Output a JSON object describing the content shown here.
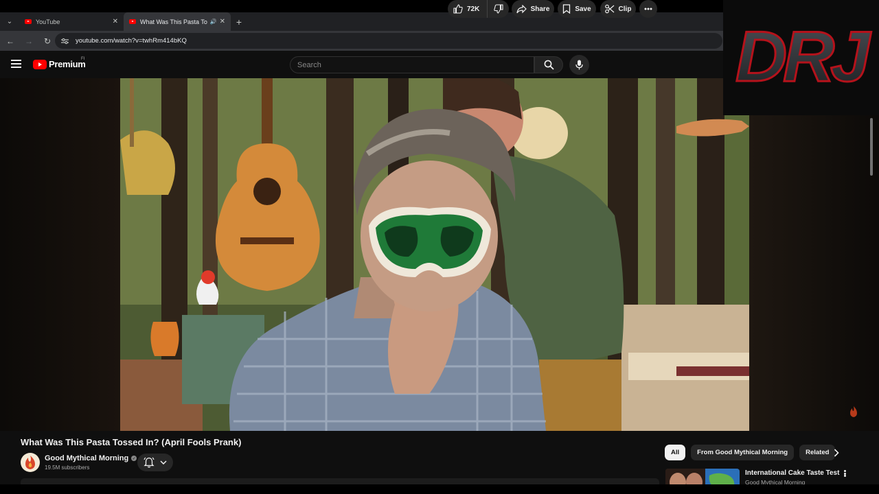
{
  "browser": {
    "tabs": [
      {
        "title": "YouTube",
        "active": false
      },
      {
        "title": "What Was This Pasta Tossed In? (April Fools Prank) - YouTube",
        "active": true
      }
    ],
    "url": "youtube.com/watch?v=twhRm414bKQ"
  },
  "overlay": {
    "logo_text": "DRJ"
  },
  "youtube": {
    "logo_word": "Premium",
    "country_code": "FI",
    "search_placeholder": "Search"
  },
  "video": {
    "title": "What Was This Pasta Tossed In? (April Fools Prank)",
    "channel": "Good Mythical Morning",
    "subscribers": "19.5M subscribers",
    "likes": "72K",
    "actions": {
      "share": "Share",
      "save": "Save",
      "clip": "Clip"
    }
  },
  "chips": [
    "All",
    "From Good Mythical Morning",
    "Related"
  ],
  "recommendation": {
    "title": "International Cake Taste Test",
    "channel": "Good Mythical Morning"
  },
  "colors": {
    "brand_red": "#ff0000",
    "background": "#0f0f0f",
    "pill": "#272727"
  }
}
